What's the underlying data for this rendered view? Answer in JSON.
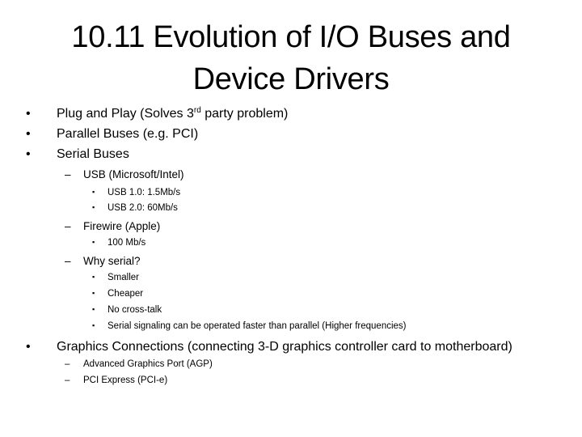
{
  "slide": {
    "title_line1": "10.11 Evolution of I/O Buses and",
    "title_line2": "Device Drivers",
    "bullets": {
      "b1_pre": "Plug and Play (Solves 3",
      "b1_sup": "rd",
      "b1_post": " party problem)",
      "b2": "Parallel Buses (e.g. PCI)",
      "b3": "Serial Buses",
      "usb": "USB (Microsoft/Intel)",
      "usb1": "USB 1.0: 1.5Mb/s",
      "usb2": "USB 2.0: 60Mb/s",
      "firewire": "Firewire  (Apple)",
      "firewire_speed": "100 Mb/s",
      "why_serial": "Why serial?",
      "smaller": "Smaller",
      "cheaper": "Cheaper",
      "no_crosstalk": "No cross-talk",
      "faster": "Serial signaling can be operated faster than parallel (Higher frequencies)",
      "b4": "Graphics Connections (connecting 3-D graphics controller card to motherboard)",
      "agp": "Advanced Graphics Port (AGP)",
      "pcie": "PCI Express (PCI-e)"
    },
    "glyphs": {
      "bullet": "•",
      "dash": "–",
      "square": "▪"
    }
  }
}
